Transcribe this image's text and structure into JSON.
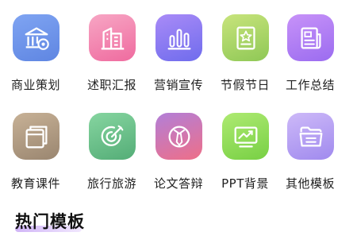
{
  "categories": [
    {
      "label": "商业策划",
      "icon": "building-coin-icon",
      "gradient": [
        "#5f8ae6",
        "#7fa4f2"
      ]
    },
    {
      "label": "述职汇报",
      "icon": "office-building-icon",
      "gradient": [
        "#f26aa0",
        "#f59bbd"
      ]
    },
    {
      "label": "营销宣传",
      "icon": "bar-chart-icon",
      "gradient": [
        "#7d6cf0",
        "#a98bf7"
      ]
    },
    {
      "label": "节假节日",
      "icon": "star-document-icon",
      "gradient": [
        "#9ccf5a",
        "#c3e27a"
      ]
    },
    {
      "label": "工作总结",
      "icon": "newspaper-icon",
      "gradient": [
        "#a26ff2",
        "#c08ef7"
      ]
    },
    {
      "label": "教育课件",
      "icon": "documents-icon",
      "gradient": [
        "#9c8a74",
        "#c2ad92"
      ]
    },
    {
      "label": "旅行旅游",
      "icon": "target-icon",
      "gradient": [
        "#5ab27d",
        "#7fd09a"
      ]
    },
    {
      "label": "论文答辩",
      "icon": "tie-icon",
      "gradient": [
        "#ec6f8e",
        "#b77fd8"
      ]
    },
    {
      "label": "PPT背景",
      "icon": "presentation-chart-icon",
      "gradient": [
        "#7fd64a",
        "#a6e86c"
      ]
    },
    {
      "label": "其他模板",
      "icon": "folder-icon",
      "gradient": [
        "#a88ef0",
        "#c7b2f7"
      ]
    }
  ],
  "section": {
    "title": "热门模板"
  }
}
